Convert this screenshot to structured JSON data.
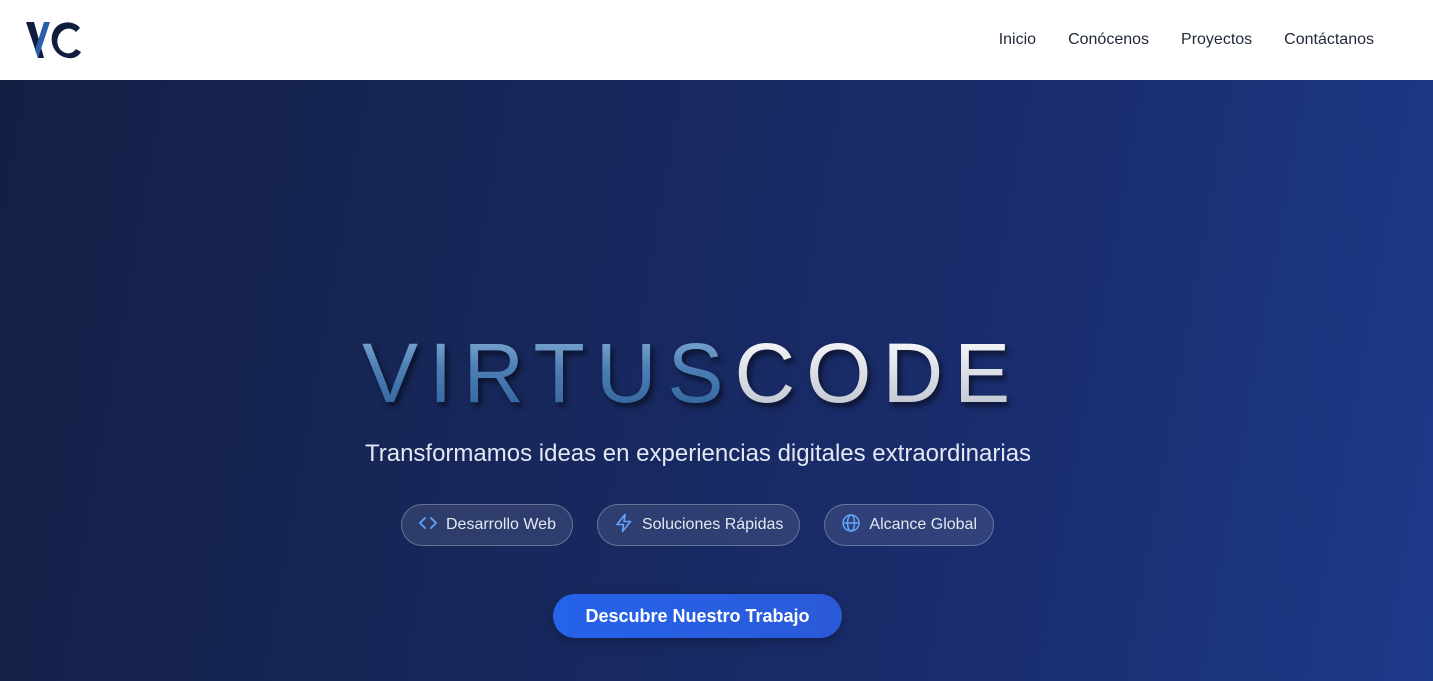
{
  "header": {
    "logo": {
      "text": "VC",
      "icon": "vc-logo-icon"
    },
    "nav": [
      {
        "label": "Inicio"
      },
      {
        "label": "Conócenos"
      },
      {
        "label": "Proyectos"
      },
      {
        "label": "Contáctanos"
      }
    ]
  },
  "hero": {
    "brand_part1": "VIRTUS",
    "brand_part2": "CODE",
    "tagline": "Transformamos ideas en experiencias digitales extraordinarias",
    "features": [
      {
        "label": "Desarrollo Web",
        "icon": "code-icon"
      },
      {
        "label": "Soluciones Rápidas",
        "icon": "lightning-icon"
      },
      {
        "label": "Alcance Global",
        "icon": "globe-icon"
      }
    ],
    "cta_label": "Descubre Nuestro Trabajo"
  },
  "colors": {
    "header_bg": "#ffffff",
    "hero_bg_start": "#141f44",
    "hero_bg_end": "#1e3a8a",
    "accent": "#2563eb",
    "icon_blue": "#60a5fa"
  }
}
